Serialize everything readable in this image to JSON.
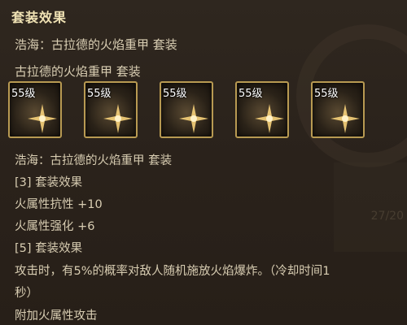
{
  "panel": {
    "title": "套装效果",
    "set_full_name": "浩海：古拉德的火焰重甲 套装",
    "set_name": "古拉德的火焰重甲 套装"
  },
  "slots": [
    {
      "level": "55级"
    },
    {
      "level": "55级"
    },
    {
      "level": "55级"
    },
    {
      "level": "55级"
    },
    {
      "level": "55级"
    }
  ],
  "details": {
    "set_header": "浩海：古拉德的火焰重甲 套装",
    "bonus3_header": "[3] 套装效果",
    "bonus3_line1": "火属性抗性 +10",
    "bonus3_line2": "火属性强化 +6",
    "bonus5_header": "[5] 套装效果",
    "bonus5_line1": "攻击时，有5%的概率对敌人随机施放火焰爆炸。（冷却时间1",
    "bonus5_line2": "秒）",
    "bonus5_line3": "附加火属性攻击"
  },
  "background": {
    "faded_number": "27/20"
  },
  "colors": {
    "title": "#f0e2b4",
    "text": "#d8cdb2",
    "slot_border": "#b89a52",
    "background": "#2c241c"
  }
}
